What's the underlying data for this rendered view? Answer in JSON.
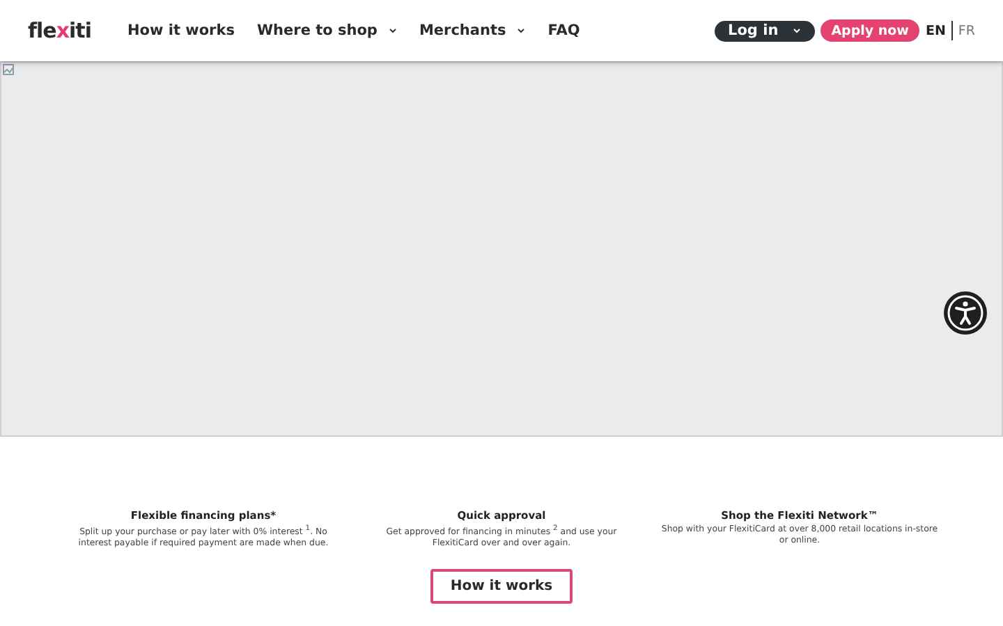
{
  "header": {
    "logo": {
      "start": "fle",
      "accent": "x",
      "end": "iti"
    },
    "nav": [
      {
        "label": "How it works",
        "dropdown": false
      },
      {
        "label": "Where to shop",
        "dropdown": true
      },
      {
        "label": "Merchants",
        "dropdown": true
      },
      {
        "label": "FAQ",
        "dropdown": false
      }
    ],
    "login": {
      "label": "Log in",
      "dropdown": true
    },
    "apply": "Apply now",
    "languages": [
      {
        "label": "EN",
        "selected": true
      },
      {
        "label": "FR",
        "selected": false
      }
    ]
  },
  "hero": {
    "kind": "broken-image"
  },
  "features": [
    {
      "title": "Flexible financing plans*",
      "text": "Split up your purchase or pay later with 0% interest $^{1}$. No interest payable if required payment are made when due."
    },
    {
      "title": "Quick approval",
      "text": "Get approved for financing in minutes $^{2}$ and use your FlexitiCard over and over again."
    },
    {
      "title": "Shop the Flexiti Network™",
      "text": "Shop with your FlexitiCard at over 8,000 retail locations in-store or online."
    }
  ],
  "cta": "How it works"
}
